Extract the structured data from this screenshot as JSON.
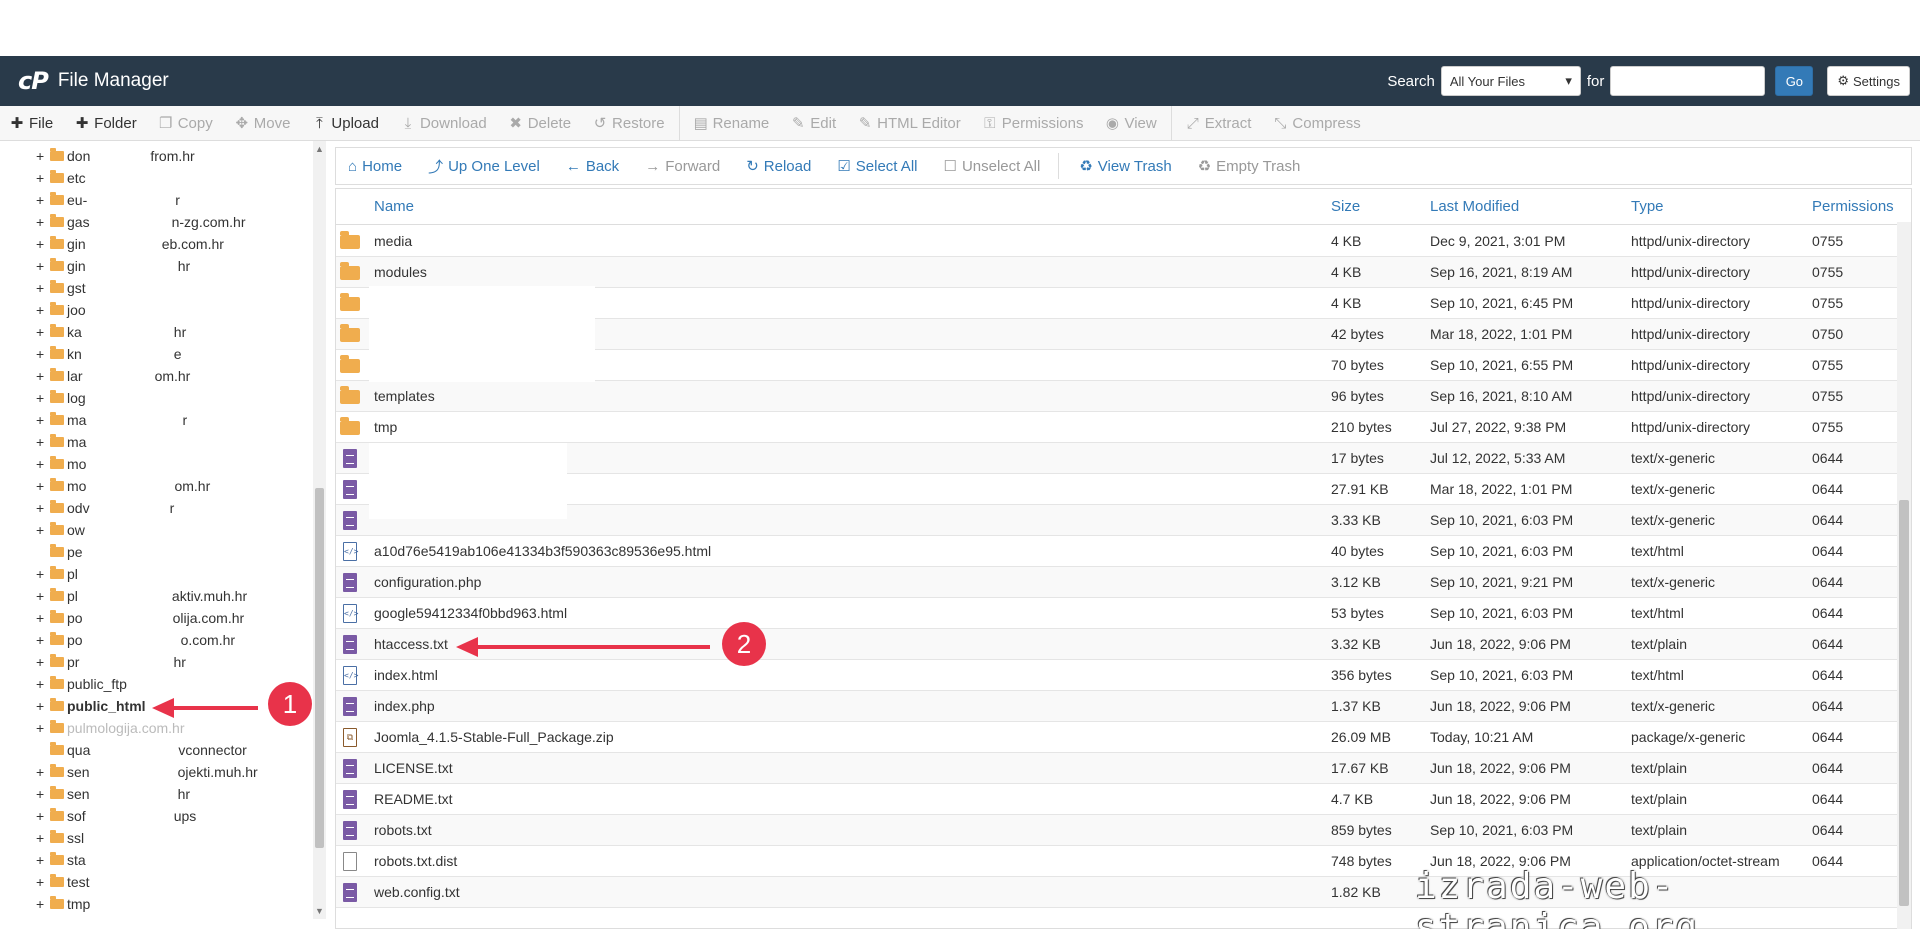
{
  "header": {
    "logo": "cP",
    "title": "File Manager",
    "search_label": "Search",
    "search_scope": "All Your Files",
    "for_label": "for",
    "search_value": "",
    "go_label": "Go",
    "settings_label": "Settings"
  },
  "toolbar": {
    "items": [
      {
        "label": "File",
        "icon": "plus-icon"
      },
      {
        "label": "Folder",
        "icon": "plus-icon"
      },
      {
        "label": "Copy",
        "icon": "copy-icon"
      },
      {
        "label": "Move",
        "icon": "move-icon"
      },
      {
        "label": "Upload",
        "icon": "upload-icon"
      },
      {
        "label": "Download",
        "icon": "download-icon"
      },
      {
        "label": "Delete",
        "icon": "close-icon"
      },
      {
        "label": "Restore",
        "icon": "restore-icon"
      },
      {
        "label": "Rename",
        "icon": "file-icon"
      },
      {
        "label": "Edit",
        "icon": "pencil-icon"
      },
      {
        "label": "HTML Editor",
        "icon": "html-editor-icon"
      },
      {
        "label": "Permissions",
        "icon": "key-icon"
      },
      {
        "label": "View",
        "icon": "eye-icon"
      },
      {
        "label": "Extract",
        "icon": "extract-icon"
      },
      {
        "label": "Compress",
        "icon": "compress-icon"
      }
    ]
  },
  "tree": {
    "items": [
      "don",
      "from.hr",
      "etc",
      "eu-",
      "r",
      "gas",
      "n-zg.com.hr",
      "gin",
      "eb.com.hr",
      "gin",
      "hr",
      "gst",
      "joo",
      "ka",
      "hr",
      "kn",
      "e",
      "lar",
      "om.hr",
      "log",
      "ma",
      "r",
      "ma",
      "mo",
      "mo",
      "om.hr",
      "odv",
      "r",
      "ow",
      "pe",
      "pl",
      "pl",
      "aktiv.muh.hr",
      "po",
      "olija.com.hr",
      "po",
      "o.com.hr",
      "pr",
      "hr",
      "public_ftp",
      "public_html",
      "pulmologija.com.hr",
      "qua",
      "vconnector",
      "sen",
      "ojekti.muh.hr",
      "sen",
      "hr",
      "sof",
      "ups",
      "ssl",
      "sta",
      "test",
      "tmp"
    ]
  },
  "nav": {
    "home": "Home",
    "up": "Up One Level",
    "back": "Back",
    "forward": "Forward",
    "reload": "Reload",
    "select_all": "Select All",
    "unselect_all": "Unselect All",
    "view_trash": "View Trash",
    "empty_trash": "Empty Trash"
  },
  "table": {
    "headers": {
      "name": "Name",
      "size": "Size",
      "modified": "Last Modified",
      "type": "Type",
      "perms": "Permissions"
    },
    "rows": [
      {
        "icon": "folder",
        "name": "media",
        "size": "4 KB",
        "modified": "Dec 9, 2021, 3:01 PM",
        "type": "httpd/unix-directory",
        "perms": "0755"
      },
      {
        "icon": "folder",
        "name": "modules",
        "size": "4 KB",
        "modified": "Sep 16, 2021, 8:19 AM",
        "type": "httpd/unix-directory",
        "perms": "0755"
      },
      {
        "icon": "folder",
        "name": "",
        "size": "4 KB",
        "modified": "Sep 10, 2021, 6:45 PM",
        "type": "httpd/unix-directory",
        "perms": "0755"
      },
      {
        "icon": "folder",
        "name": "",
        "size": "42 bytes",
        "modified": "Mar 18, 2022, 1:01 PM",
        "type": "httpd/unix-directory",
        "perms": "0750"
      },
      {
        "icon": "folder",
        "name": "",
        "size": "70 bytes",
        "modified": "Sep 10, 2021, 6:55 PM",
        "type": "httpd/unix-directory",
        "perms": "0755"
      },
      {
        "icon": "folder",
        "name": "templates",
        "size": "96 bytes",
        "modified": "Sep 16, 2021, 8:10 AM",
        "type": "httpd/unix-directory",
        "perms": "0755"
      },
      {
        "icon": "folder",
        "name": "tmp",
        "size": "210 bytes",
        "modified": "Jul 27, 2022, 9:38 PM",
        "type": "httpd/unix-directory",
        "perms": "0755"
      },
      {
        "icon": "doc",
        "name": "",
        "size": "17 bytes",
        "modified": "Jul 12, 2022, 5:33 AM",
        "type": "text/x-generic",
        "perms": "0644"
      },
      {
        "icon": "doc",
        "name": "",
        "size": "27.91 KB",
        "modified": "Mar 18, 2022, 1:01 PM",
        "type": "text/x-generic",
        "perms": "0644"
      },
      {
        "icon": "doc",
        "name": "",
        "size": "3.33 KB",
        "modified": "Sep 10, 2021, 6:03 PM",
        "type": "text/x-generic",
        "perms": "0644"
      },
      {
        "icon": "html",
        "name": "a10d76e5419ab106e41334b3f590363c89536e95.html",
        "size": "40 bytes",
        "modified": "Sep 10, 2021, 6:03 PM",
        "type": "text/html",
        "perms": "0644"
      },
      {
        "icon": "doc",
        "name": "configuration.php",
        "size": "3.12 KB",
        "modified": "Sep 10, 2021, 9:21 PM",
        "type": "text/x-generic",
        "perms": "0644"
      },
      {
        "icon": "html",
        "name": "google59412334f0bbd963.html",
        "size": "53 bytes",
        "modified": "Sep 10, 2021, 6:03 PM",
        "type": "text/html",
        "perms": "0644"
      },
      {
        "icon": "doc",
        "name": "htaccess.txt",
        "size": "3.32 KB",
        "modified": "Jun 18, 2022, 9:06 PM",
        "type": "text/plain",
        "perms": "0644"
      },
      {
        "icon": "html",
        "name": "index.html",
        "size": "356 bytes",
        "modified": "Sep 10, 2021, 6:03 PM",
        "type": "text/html",
        "perms": "0644"
      },
      {
        "icon": "doc",
        "name": "index.php",
        "size": "1.37 KB",
        "modified": "Jun 18, 2022, 9:06 PM",
        "type": "text/x-generic",
        "perms": "0644"
      },
      {
        "icon": "zip",
        "name": "Joomla_4.1.5-Stable-Full_Package.zip",
        "size": "26.09 MB",
        "modified": "Today, 10:21 AM",
        "type": "package/x-generic",
        "perms": "0644"
      },
      {
        "icon": "doc",
        "name": "LICENSE.txt",
        "size": "17.67 KB",
        "modified": "Jun 18, 2022, 9:06 PM",
        "type": "text/plain",
        "perms": "0644"
      },
      {
        "icon": "doc",
        "name": "README.txt",
        "size": "4.7 KB",
        "modified": "Jun 18, 2022, 9:06 PM",
        "type": "text/plain",
        "perms": "0644"
      },
      {
        "icon": "doc",
        "name": "robots.txt",
        "size": "859 bytes",
        "modified": "Sep 10, 2021, 6:03 PM",
        "type": "text/plain",
        "perms": "0644"
      },
      {
        "icon": "blank",
        "name": "robots.txt.dist",
        "size": "748 bytes",
        "modified": "Jun 18, 2022, 9:06 PM",
        "type": "application/octet-stream",
        "perms": "0644"
      },
      {
        "icon": "doc",
        "name": "web.config.txt",
        "size": "1.82 KB",
        "modified": "",
        "type": "",
        "perms": ""
      }
    ]
  },
  "annotations": {
    "one": "1",
    "two": "2"
  },
  "watermark": "izrada-web-stranica.org",
  "colors": {
    "header_bg": "#293a4a",
    "link": "#337ab7",
    "folder": "#f0ad4e",
    "doc": "#7a5aa5",
    "annotation": "#e8334a"
  }
}
